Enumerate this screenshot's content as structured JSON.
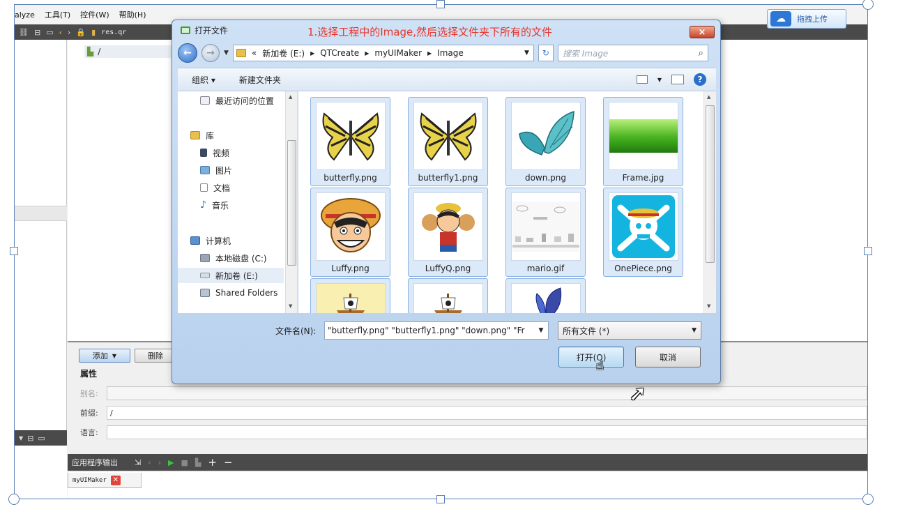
{
  "background_app": {
    "menu": [
      "alyze",
      "工具(T)",
      "控件(W)",
      "帮助(H)"
    ],
    "toolbar_file": "res.qr",
    "tree_root": "/",
    "add_button": "添加",
    "delete_button": "删除",
    "properties_title": "属性",
    "props": [
      {
        "label": "别名:",
        "value": ""
      },
      {
        "label": "前缀:",
        "value": "/"
      },
      {
        "label": "语言:",
        "value": ""
      }
    ],
    "output_title": "应用程序输出",
    "output_tab": "myUIMaker",
    "upload_button": "拖拽上传"
  },
  "dialog": {
    "title": "打开文件",
    "annotation": "1.选择工程中的Image,然后选择文件夹下所有的文件",
    "close_label": "×",
    "breadcrumb": [
      "«",
      "新加卷 (E:)",
      "QTCreate",
      "myUIMaker",
      "Image"
    ],
    "search_placeholder": "搜索 Image",
    "commands": {
      "organize": "组织 ▾",
      "new_folder": "新建文件夹"
    },
    "nav": {
      "recent": "最近访问的位置",
      "library": "库",
      "videos": "视频",
      "pictures": "图片",
      "documents": "文档",
      "music": "音乐",
      "computer": "计算机",
      "drive_c": "本地磁盘 (C:)",
      "drive_e": "新加卷 (E:)",
      "shared": "Shared Folders"
    },
    "files": [
      {
        "name": "butterfly.png",
        "icon": "butterfly-yellow"
      },
      {
        "name": "butterfly1.png",
        "icon": "butterfly-yellow"
      },
      {
        "name": "down.png",
        "icon": "butterfly-teal"
      },
      {
        "name": "Frame.jpg",
        "icon": "green-landscape"
      },
      {
        "name": "Luffy.png",
        "icon": "luffy-face"
      },
      {
        "name": "LuffyQ.png",
        "icon": "luffy-chibi"
      },
      {
        "name": "mario.gif",
        "icon": "mario-sprites"
      },
      {
        "name": "OnePiece.png",
        "icon": "jolly-roger"
      },
      {
        "name": "",
        "icon": "ship"
      },
      {
        "name": "",
        "icon": "ship"
      },
      {
        "name": "",
        "icon": "butterfly-blue"
      }
    ],
    "filename_label": "文件名(N):",
    "filename_value": "\"butterfly.png\" \"butterfly1.png\" \"down.png\" \"Fr",
    "filetype_value": "所有文件 (*)",
    "open_button": "打开(O)",
    "cancel_button": "取消"
  }
}
